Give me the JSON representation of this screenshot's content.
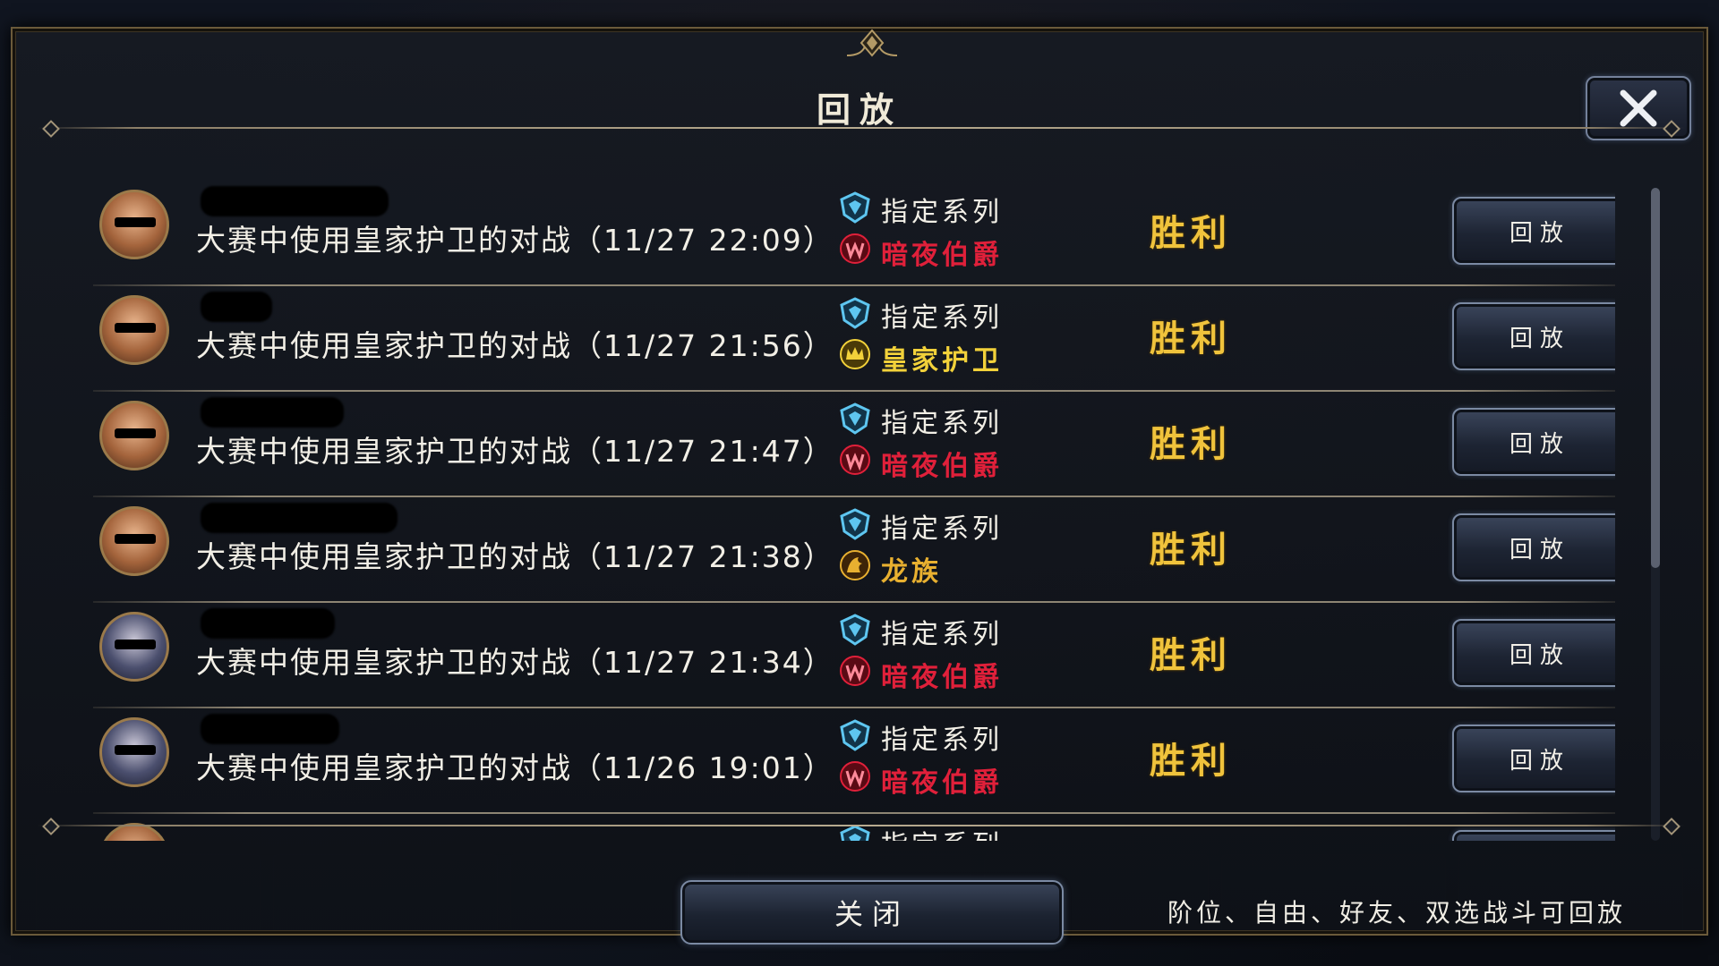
{
  "dialog": {
    "title": "回放",
    "close_button_label": "关闭",
    "footer_note": "阶位、自由、好友、双选战斗可回放"
  },
  "colors": {
    "result_gold": "#f0c33c",
    "night_count_red": "#e0203a",
    "royal_guard_gold": "#f2d13a",
    "dragon_gold": "#e8b030",
    "series_cyan": "#5ec6f0"
  },
  "rows": [
    {
      "desc": "大赛中使用皇家护卫的对战（11/27 22:09）",
      "series": "指定系列",
      "class_name": "暗夜伯爵",
      "class_icon": "night-count-icon",
      "result": "胜利",
      "button": "回放"
    },
    {
      "desc": "大赛中使用皇家护卫的对战（11/27 21:56）",
      "series": "指定系列",
      "class_name": "皇家护卫",
      "class_icon": "royal-guard-icon",
      "result": "胜利",
      "button": "回放"
    },
    {
      "desc": "大赛中使用皇家护卫的对战（11/27 21:47）",
      "series": "指定系列",
      "class_name": "暗夜伯爵",
      "class_icon": "night-count-icon",
      "result": "胜利",
      "button": "回放"
    },
    {
      "desc": "大赛中使用皇家护卫的对战（11/27 21:38）",
      "series": "指定系列",
      "class_name": "龙族",
      "class_icon": "dragon-icon",
      "result": "胜利",
      "button": "回放"
    },
    {
      "desc": "大赛中使用皇家护卫的对战（11/27 21:34）",
      "series": "指定系列",
      "class_name": "暗夜伯爵",
      "class_icon": "night-count-icon",
      "result": "胜利",
      "button": "回放"
    },
    {
      "desc": "大赛中使用皇家护卫的对战（11/26 19:01）",
      "series": "指定系列",
      "class_name": "暗夜伯爵",
      "class_icon": "night-count-icon",
      "result": "胜利",
      "button": "回放"
    },
    {
      "desc": "",
      "series": "指定系列",
      "class_name": "",
      "class_icon": "",
      "result": "",
      "button": ""
    }
  ]
}
